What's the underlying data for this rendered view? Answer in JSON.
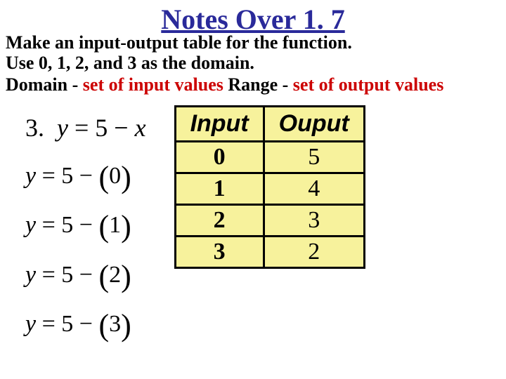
{
  "title": "Notes Over 1. 7",
  "instructions": {
    "line1": "Make an input-output table for the function.",
    "line2": "Use 0, 1, 2, and 3 as the domain."
  },
  "definitions": {
    "domain_label": "Domain - ",
    "domain_value": "set of input values",
    "gap": "  ",
    "range_label": "Range - ",
    "range_value": "set of output values"
  },
  "problem": {
    "number": "3.",
    "equation": "y = 5 − x",
    "lines": [
      "0",
      "1",
      "2",
      "3"
    ]
  },
  "table": {
    "head_input": "Input",
    "head_output": "Ouput",
    "rows": [
      {
        "input": "0",
        "output": "5"
      },
      {
        "input": "1",
        "output": "4"
      },
      {
        "input": "2",
        "output": "3"
      },
      {
        "input": "3",
        "output": "2"
      }
    ]
  }
}
